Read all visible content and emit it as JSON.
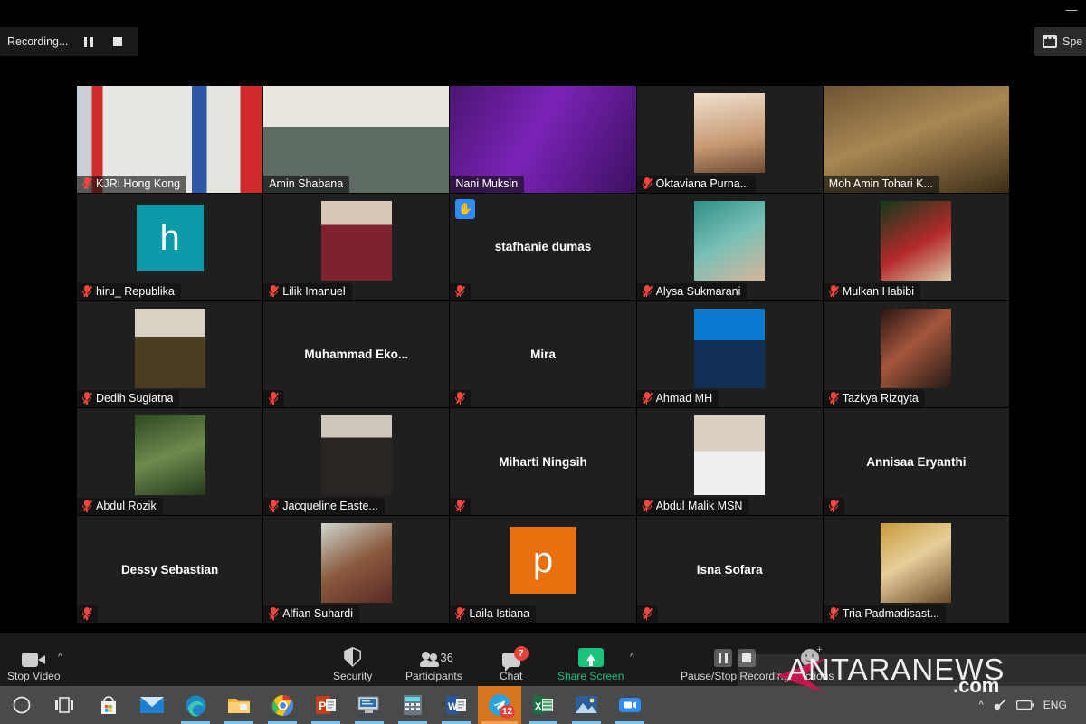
{
  "window": {
    "minimize_glyph": "—"
  },
  "recording_bar": {
    "status_text": "Recording...",
    "pause_icon": "pause-icon",
    "stop_icon": "stop-icon"
  },
  "view_button": {
    "label": "Spe",
    "icon": "speaker-view-icon"
  },
  "gallery": {
    "tiles": [
      {
        "name": "KJRI Hong Kong",
        "label_position": "bottom",
        "muted": true,
        "hand_raised": false,
        "video": "office-flags",
        "active": false
      },
      {
        "name": "Amin Shabana",
        "label_position": "bottom",
        "muted": false,
        "hand_raised": false,
        "video": "man-white-wall",
        "active": true
      },
      {
        "name": "Nani Muksin",
        "label_position": "bottom",
        "muted": false,
        "hand_raised": false,
        "video": "purple-banner-woman",
        "active": false
      },
      {
        "name": "Oktaviana Purna...",
        "label_position": "bottom",
        "muted": true,
        "hand_raised": false,
        "video": "photo-hijab-woman",
        "active": false
      },
      {
        "name": "Moh Amin Tohari K...",
        "label_position": "bottom",
        "muted": false,
        "hand_raised": false,
        "video": "man-carved-wall",
        "active": false
      },
      {
        "name": "hiru_ Republika",
        "label_position": "bottom",
        "muted": true,
        "hand_raised": false,
        "video": "avatar-letter",
        "avatar_letter": "h",
        "avatar_color": "#0d9aa8",
        "active": false
      },
      {
        "name": "Lilik Imanuel",
        "label_position": "bottom",
        "muted": true,
        "hand_raised": false,
        "video": "woman-red-jacket",
        "active": false
      },
      {
        "name": "stafhanie dumas",
        "label_position": "center",
        "muted": true,
        "hand_raised": true,
        "video": "none",
        "active": false
      },
      {
        "name": "Alysa Sukmarani",
        "label_position": "bottom",
        "muted": true,
        "hand_raised": false,
        "video": "photo-teal-hijab",
        "active": false
      },
      {
        "name": "Mulkan Habibi",
        "label_position": "bottom",
        "muted": true,
        "hand_raised": false,
        "video": "photo-man-red-shirt",
        "active": false
      },
      {
        "name": "Dedih Sugiatna",
        "label_position": "bottom",
        "muted": true,
        "hand_raised": false,
        "video": "man-batik-shirt",
        "active": false
      },
      {
        "name": "Muhammad  Eko...",
        "label_position": "center",
        "muted": true,
        "hand_raised": false,
        "video": "none",
        "active": false
      },
      {
        "name": "Mira",
        "label_position": "center",
        "muted": true,
        "hand_raised": false,
        "video": "none",
        "active": false
      },
      {
        "name": "Ahmad MH",
        "label_position": "bottom",
        "muted": true,
        "hand_raised": false,
        "video": "photo-blue-bg-suit",
        "active": false
      },
      {
        "name": "Tazkya Rizqyta",
        "label_position": "bottom",
        "muted": true,
        "hand_raised": false,
        "video": "photo-woman-lights",
        "active": false
      },
      {
        "name": "Abdul Rozik",
        "label_position": "bottom",
        "muted": true,
        "hand_raised": false,
        "video": "photo-man-forest",
        "active": false
      },
      {
        "name": "Jacqueline Easte...",
        "label_position": "bottom",
        "muted": true,
        "hand_raised": false,
        "video": "photo-mirror-selfie",
        "active": false
      },
      {
        "name": "Miharti Ningsih",
        "label_position": "center",
        "muted": true,
        "hand_raised": false,
        "video": "none",
        "active": false
      },
      {
        "name": "Abdul Malik MSN",
        "label_position": "bottom",
        "muted": true,
        "hand_raised": false,
        "video": "man-white-tshirt",
        "active": false
      },
      {
        "name": "Annisaa Eryanthi",
        "label_position": "center",
        "muted": true,
        "hand_raised": false,
        "video": "none",
        "active": false
      },
      {
        "name": "Dessy Sebastian",
        "label_position": "center",
        "muted": true,
        "hand_raised": false,
        "video": "none",
        "active": false
      },
      {
        "name": "Alfian Suhardi",
        "label_position": "bottom",
        "muted": true,
        "hand_raised": false,
        "video": "photo-man-plaid",
        "active": false
      },
      {
        "name": "Laila Istiana",
        "label_position": "bottom",
        "muted": true,
        "hand_raised": false,
        "video": "avatar-letter",
        "avatar_letter": "p",
        "avatar_color": "#e8700f",
        "active": false
      },
      {
        "name": "Isna Sofara",
        "label_position": "center",
        "muted": true,
        "hand_raised": false,
        "video": "none",
        "active": false
      },
      {
        "name": "Tria Padmadisast...",
        "label_position": "bottom",
        "muted": true,
        "hand_raised": false,
        "video": "photo-woman-gold",
        "active": false
      }
    ]
  },
  "toolbar": {
    "stop_video_label": "Stop Video",
    "security_label": "Security",
    "participants_label": "Participants",
    "participants_count": "36",
    "chat_label": "Chat",
    "chat_badge": "7",
    "share_screen_label": "Share Screen",
    "recording_label": "Pause/Stop Recording",
    "reactions_label": "Reactions",
    "share_accent": "#19c37d"
  },
  "watermark": {
    "main": "ANTARANEWS",
    "sub": ".com",
    "accent": "#c2184b"
  },
  "taskbar": {
    "items": [
      {
        "icon": "start-icon",
        "state": "idle"
      },
      {
        "icon": "task-view-icon",
        "state": "idle"
      },
      {
        "icon": "microsoft-store-icon",
        "state": "idle"
      },
      {
        "icon": "mail-icon",
        "state": "idle"
      },
      {
        "icon": "edge-icon",
        "state": "open"
      },
      {
        "icon": "file-explorer-icon",
        "state": "open"
      },
      {
        "icon": "chrome-icon",
        "state": "open"
      },
      {
        "icon": "powerpoint-icon",
        "state": "open"
      },
      {
        "icon": "remote-desktop-icon",
        "state": "open"
      },
      {
        "icon": "calculator-icon",
        "state": "open"
      },
      {
        "icon": "word-icon",
        "state": "open"
      },
      {
        "icon": "telegram-icon",
        "state": "active",
        "badge": "12"
      },
      {
        "icon": "excel-icon",
        "state": "open"
      },
      {
        "icon": "photos-icon",
        "state": "open"
      },
      {
        "icon": "zoom-icon",
        "state": "open"
      }
    ],
    "tray": {
      "chevron": "^",
      "language": "ENG",
      "network_icon": "network-icon",
      "battery_icon": "battery-icon"
    }
  }
}
